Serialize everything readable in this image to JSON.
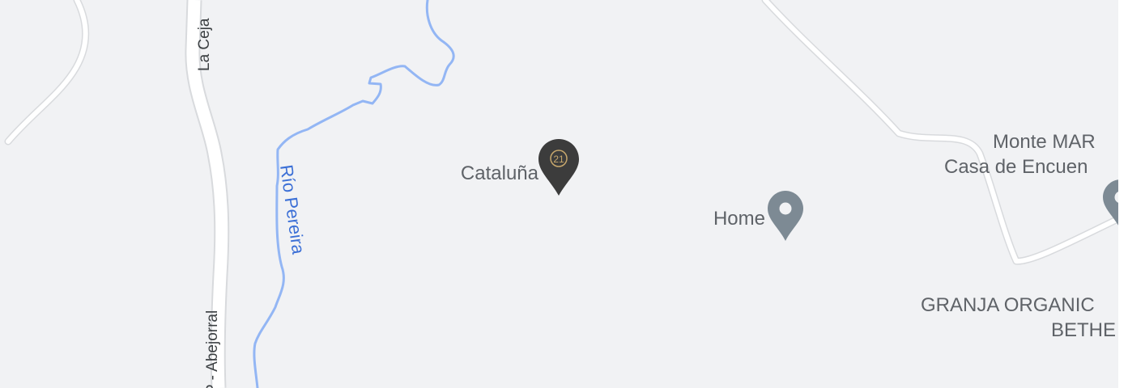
{
  "map": {
    "colors": {
      "land": "#f1f2f4",
      "road": "#ffffff",
      "road_edge": "#d8dadd",
      "river": "#93b6f4",
      "river_label": "#3b6fd6",
      "poi_label": "#5f6368",
      "road_label": "#3c4043",
      "pin_generic": "#7d8a94",
      "pin_realestate": "#3c3c3c",
      "pin_logo": "#c7a76c"
    },
    "roads": {
      "la_ceja": "La Ceja",
      "abejorral": "P - Abejorral"
    },
    "river": {
      "name": "Río Pereira"
    },
    "places": {
      "cataluna": {
        "label": "Cataluña",
        "icon": "century-21-pin-icon",
        "logo": "21"
      },
      "home": {
        "label": "Home",
        "icon": "location-pin-icon"
      },
      "monte_mar_line1": "Monte MAR",
      "monte_mar_line2": "Casa de Encuen",
      "granja_line1": "GRANJA ORGANIC",
      "granja_line2": "BETHE"
    }
  }
}
